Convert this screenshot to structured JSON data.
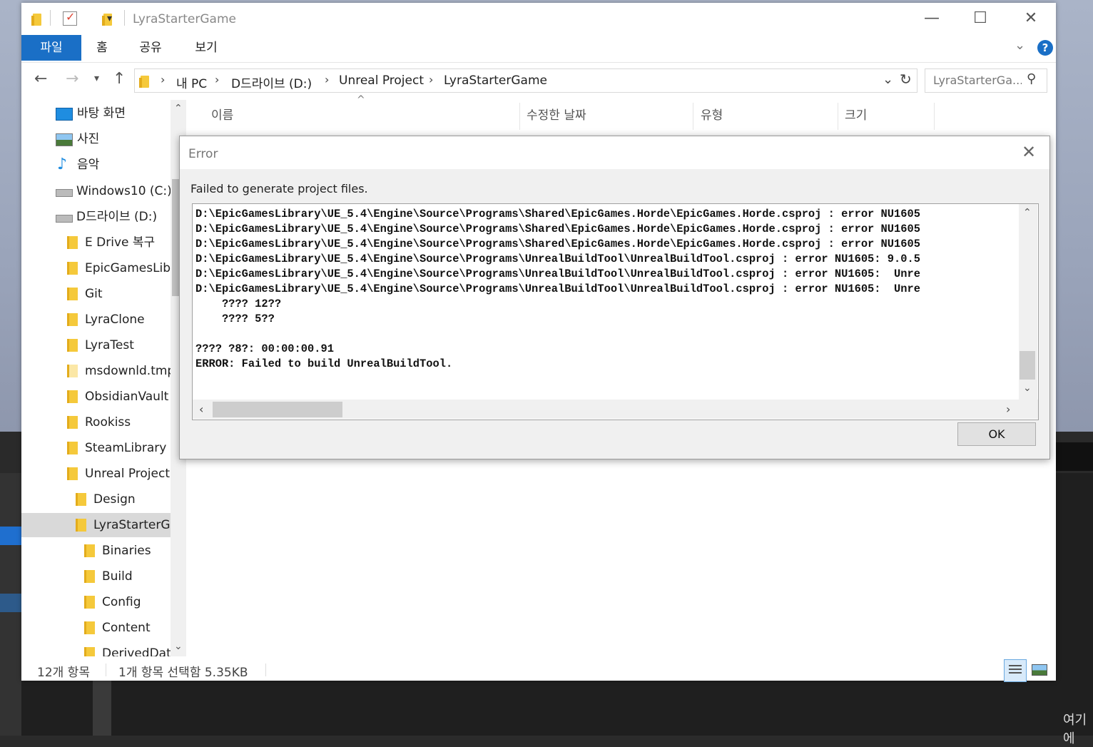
{
  "window": {
    "title": "LyraStarterGame",
    "min_glyph": "—",
    "max_glyph": "☐",
    "close_glyph": "✕"
  },
  "ribbon": {
    "tabs": [
      "파일",
      "홈",
      "공유",
      "보기"
    ],
    "help": "?"
  },
  "address": {
    "crumbs": [
      "내 PC",
      "D드라이브 (D:)",
      "Unreal Project",
      "LyraStarterGame"
    ],
    "search_placeholder": "LyraStarterGa..."
  },
  "sidebar": {
    "items": [
      {
        "label": "바탕 화면",
        "icon": "desktop-icon"
      },
      {
        "label": "사진",
        "icon": "pictures-icon"
      },
      {
        "label": "음악",
        "icon": "music-icon"
      },
      {
        "label": "Windows10 (C:)",
        "icon": "drive-icon"
      },
      {
        "label": "D드라이브 (D:)",
        "icon": "drive-icon"
      },
      {
        "label": "E Drive 복구",
        "icon": "folder-icon"
      },
      {
        "label": "EpicGamesLibr",
        "icon": "folder-icon"
      },
      {
        "label": "Git",
        "icon": "folder-icon"
      },
      {
        "label": "LyraClone",
        "icon": "folder-icon"
      },
      {
        "label": "LyraTest",
        "icon": "folder-icon"
      },
      {
        "label": "msdownld.tmp",
        "icon": "folder-icon"
      },
      {
        "label": "ObsidianVault",
        "icon": "folder-icon"
      },
      {
        "label": "Rookiss",
        "icon": "folder-icon"
      },
      {
        "label": "SteamLibrary",
        "icon": "folder-icon"
      },
      {
        "label": "Unreal Project",
        "icon": "folder-icon"
      },
      {
        "label": "Design",
        "icon": "folder-icon"
      },
      {
        "label": "LyraStarterGa",
        "icon": "folder-icon"
      },
      {
        "label": "Binaries",
        "icon": "folder-icon"
      },
      {
        "label": "Build",
        "icon": "folder-icon"
      },
      {
        "label": "Config",
        "icon": "folder-icon"
      },
      {
        "label": "Content",
        "icon": "folder-icon"
      },
      {
        "label": "DerivedData",
        "icon": "folder-icon"
      }
    ]
  },
  "columns": [
    "이름",
    "수정한 날짜",
    "유형",
    "크기"
  ],
  "status": {
    "count": "12개 항목",
    "selection": "1개 항목 선택함 5.35KB"
  },
  "dialog": {
    "title": "Error",
    "message": "Failed to generate project files.",
    "lines": [
      "D:\\EpicGamesLibrary\\UE_5.4\\Engine\\Source\\Programs\\Shared\\EpicGames.Horde\\EpicGames.Horde.csproj : error NU1605",
      "D:\\EpicGamesLibrary\\UE_5.4\\Engine\\Source\\Programs\\Shared\\EpicGames.Horde\\EpicGames.Horde.csproj : error NU1605",
      "D:\\EpicGamesLibrary\\UE_5.4\\Engine\\Source\\Programs\\Shared\\EpicGames.Horde\\EpicGames.Horde.csproj : error NU1605",
      "D:\\EpicGamesLibrary\\UE_5.4\\Engine\\Source\\Programs\\UnrealBuildTool\\UnrealBuildTool.csproj : error NU1605: 9.0.5",
      "D:\\EpicGamesLibrary\\UE_5.4\\Engine\\Source\\Programs\\UnrealBuildTool\\UnrealBuildTool.csproj : error NU1605:  Unre",
      "D:\\EpicGamesLibrary\\UE_5.4\\Engine\\Source\\Programs\\UnrealBuildTool\\UnrealBuildTool.csproj : error NU1605:  Unre",
      "    ???? 12??",
      "    ???? 5??",
      "",
      "???? ?8?: 00:00:00.91",
      "ERROR: Failed to build UnrealBuildTool."
    ],
    "ok_label": "OK"
  },
  "desktop": {
    "corner_text": "여기에"
  }
}
